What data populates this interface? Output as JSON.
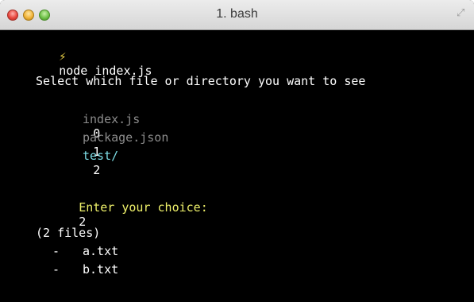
{
  "window": {
    "title": "1. bash"
  },
  "icons": {
    "resize": "fullscreen-arrows-icon",
    "prompt": "lightning-bolt-icon"
  },
  "colors": {
    "background": "#000000",
    "prompt": "#f3d84a",
    "dim_item": "#8c8c8c",
    "directory": "#7ddde6",
    "input_label": "#eef06a"
  },
  "terminal": {
    "prompt_glyph": "⚡",
    "command": "node index.js",
    "question": "Select which file or directory you want to see",
    "items": [
      {
        "index": "0",
        "name": "index.js"
      },
      {
        "index": "1",
        "name": "package.json"
      },
      {
        "index": "2",
        "name": "test/"
      }
    ],
    "choice_label": "Enter your choice:",
    "choice_value": "2",
    "summary": "(2 files)",
    "files": [
      {
        "bullet": "-",
        "name": "a.txt"
      },
      {
        "bullet": "-",
        "name": "b.txt"
      }
    ]
  }
}
